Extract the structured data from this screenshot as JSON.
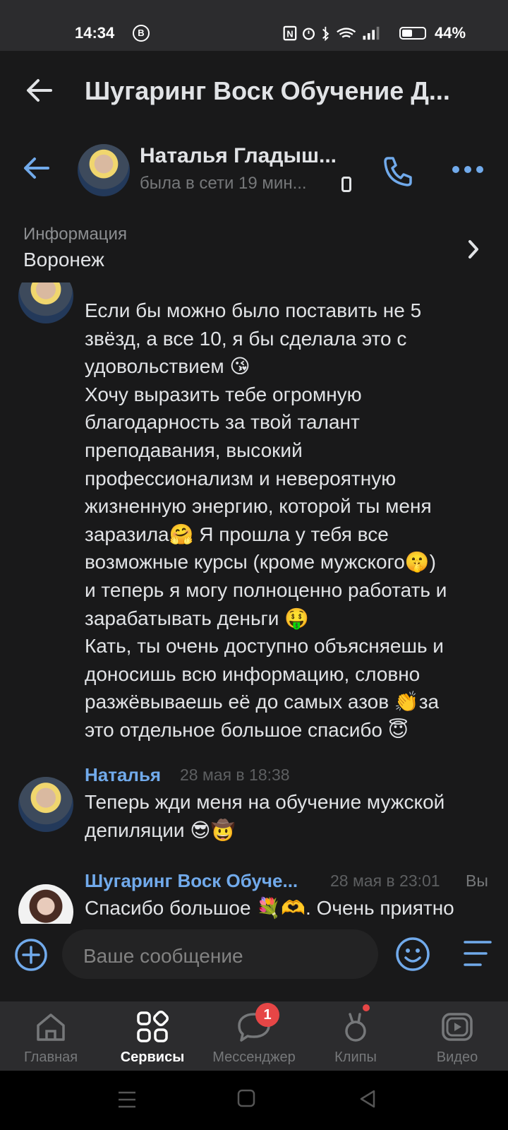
{
  "status_bar": {
    "time": "14:34",
    "badge_icon": "b-circle-icon",
    "battery": "44%"
  },
  "header": {
    "title": "Шугаринг Воск Обучение Д..."
  },
  "chat": {
    "contact_name": "Наталья Гладыш...",
    "last_seen": "была в сети 19 мин..."
  },
  "info": {
    "label": "Информация",
    "value": "Воронеж"
  },
  "messages": [
    {
      "text": "Если бы можно было поставить не 5\nзвёзд, а все 10, я бы сделала это с\nудовольствием 😘\nХочу выразить тебе огромную\nблагодарность за твой талант\nпреподавания, высокий\nпрофессионализм и невероятную\nжизненную энергию, которой ты меня\nзаразила🤗 Я прошла у тебя все\nвозможные курсы (кроме мужского🤫)\nи теперь я могу полноценно работать и\nзарабатывать деньги 🤑\nКать, ты очень доступно объясняешь и\nдоносишь всю информацию, словно\nразжёвываешь её до самых азов 👏за\nэто отдельное большое спасибо 😇"
    },
    {
      "sender": "Наталья",
      "time": "28 мая в 18:38",
      "text": "Теперь жди меня на обучение мужской\nдепиляции 😎🤠"
    },
    {
      "sender": "Шугаринг Воск Обуче...",
      "time": "28 мая в 23:01",
      "own_label": "Вы",
      "text": "Спасибо большое 💐🫶. Очень приятно"
    }
  ],
  "composer": {
    "placeholder": "Ваше сообщение"
  },
  "bottom_nav": [
    {
      "label": "Главная",
      "icon": "home-icon",
      "active": false
    },
    {
      "label": "Сервисы",
      "icon": "services-icon",
      "active": true
    },
    {
      "label": "Мессенджер",
      "icon": "messenger-icon",
      "active": false,
      "badge": "1"
    },
    {
      "label": "Клипы",
      "icon": "clips-icon",
      "active": false
    },
    {
      "label": "Видео",
      "icon": "video-icon",
      "active": false
    }
  ],
  "colors": {
    "accent": "#71aaeb",
    "background": "#19191a",
    "badge": "#e64646"
  }
}
